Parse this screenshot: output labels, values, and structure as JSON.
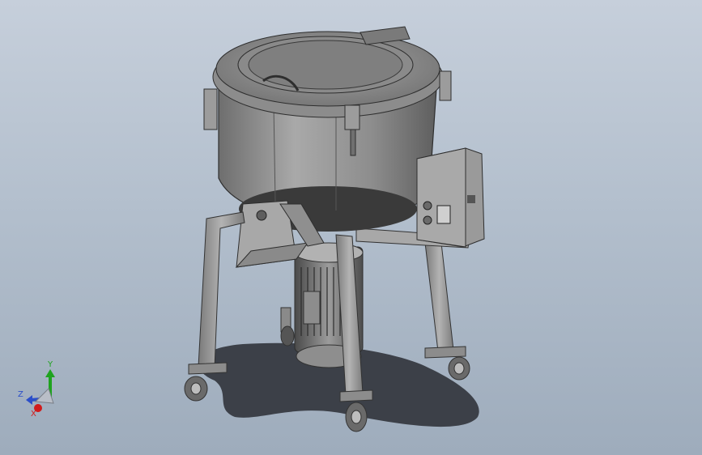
{
  "triad": {
    "y_label": "Y",
    "z_label": "Z",
    "x_label": "X",
    "colors": {
      "y": "#1fa31f",
      "z": "#2b4fc9",
      "x": "#d11b1b"
    }
  },
  "scene": {
    "background_top": "#c6cfdb",
    "background_bottom": "#9eacbc",
    "metal": "#9a9a9a",
    "shadow": "#3c4048"
  }
}
